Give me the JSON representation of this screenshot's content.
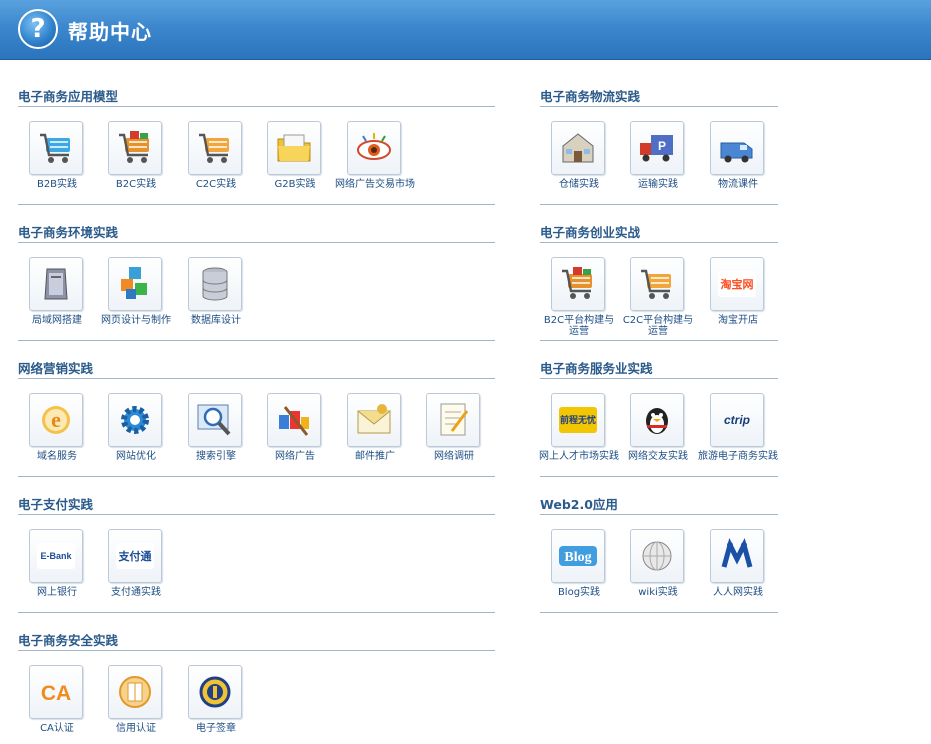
{
  "header": {
    "title": "帮助中心",
    "icon": "question-icon"
  },
  "sections": [
    {
      "title": "电子商务应用模型",
      "items": [
        {
          "label": "B2B实践",
          "icon": "cart-blue-icon"
        },
        {
          "label": "B2C实践",
          "icon": "cart-gift-icon"
        },
        {
          "label": "C2C实践",
          "icon": "cart-orange-icon"
        },
        {
          "label": "G2B实践",
          "icon": "folder-icon"
        },
        {
          "label": "网络广告交易市场",
          "icon": "eye-icon"
        }
      ]
    },
    {
      "title": "电子商务环境实践",
      "items": [
        {
          "label": "局域网搭建",
          "icon": "server-tower-icon"
        },
        {
          "label": "网页设计与制作",
          "icon": "blocks-icon"
        },
        {
          "label": "数据库设计",
          "icon": "database-icon"
        }
      ]
    },
    {
      "title": "网络营销实践",
      "items": [
        {
          "label": "域名服务",
          "icon": "ie-icon"
        },
        {
          "label": "网站优化",
          "icon": "gear-icon"
        },
        {
          "label": "搜索引擎",
          "icon": "magnifier-icon"
        },
        {
          "label": "网络广告",
          "icon": "paint-icon"
        },
        {
          "label": "邮件推广",
          "icon": "envelope-icon"
        },
        {
          "label": "网络调研",
          "icon": "notepad-icon"
        }
      ]
    },
    {
      "title": "电子支付实践",
      "items": [
        {
          "label": "网上银行",
          "icon": "ebank-logo-icon",
          "logo": "E-Bank"
        },
        {
          "label": "支付通实践",
          "icon": "zhifutong-logo-icon",
          "logo": "支付通"
        }
      ]
    },
    {
      "title": "电子商务安全实践",
      "items": [
        {
          "label": "CA认证",
          "icon": "ca-logo-icon",
          "logo": "CA"
        },
        {
          "label": "信用认证",
          "icon": "credit-icon"
        },
        {
          "label": "电子签章",
          "icon": "seal-icon"
        }
      ]
    },
    {
      "title": "电子商务物流实践",
      "items": [
        {
          "label": "仓储实践",
          "icon": "warehouse-icon"
        },
        {
          "label": "运输实践",
          "icon": "truck-icon"
        },
        {
          "label": "物流课件",
          "icon": "van-icon"
        }
      ]
    },
    {
      "title": "电子商务创业实战",
      "items": [
        {
          "label": "B2C平台构建与运营",
          "icon": "cart-gift-icon"
        },
        {
          "label": "C2C平台构建与运营",
          "icon": "cart-orange-icon"
        },
        {
          "label": "淘宝开店",
          "icon": "taobao-logo-icon",
          "logo": "淘宝网"
        }
      ]
    },
    {
      "title": "电子商务服务业实践",
      "items": [
        {
          "label": "网上人才市场实践",
          "icon": "job-logo-icon",
          "logo": "前程无忧"
        },
        {
          "label": "网络交友实践",
          "icon": "qq-penguin-icon"
        },
        {
          "label": "旅游电子商务实践",
          "icon": "ctrip-logo-icon",
          "logo": "ctrip"
        }
      ]
    },
    {
      "title": "Web2.0应用",
      "items": [
        {
          "label": "Blog实践",
          "icon": "blog-logo-icon",
          "logo": "Blog"
        },
        {
          "label": "wiki实践",
          "icon": "wiki-globe-icon"
        },
        {
          "label": "人人网实践",
          "icon": "renren-logo-icon"
        }
      ]
    }
  ]
}
